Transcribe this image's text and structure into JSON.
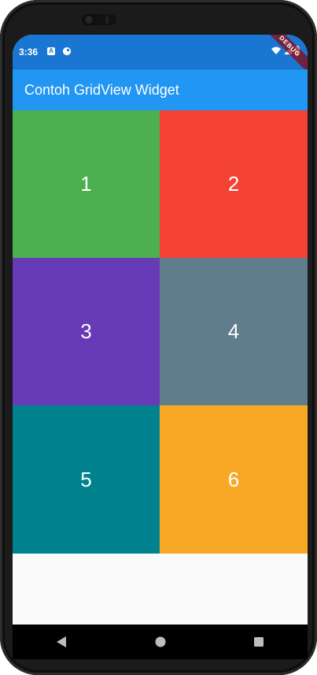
{
  "status_bar": {
    "time": "3:36",
    "debug_banner": "DEBUG",
    "icons": [
      "notification-a-icon",
      "notification-palette-icon",
      "wifi-icon",
      "signal-icon",
      "battery-icon"
    ]
  },
  "app_bar": {
    "title": "Contoh GridView Widget",
    "color": "#2196f3"
  },
  "grid": {
    "tiles": [
      {
        "label": "1",
        "color": "#4caf50"
      },
      {
        "label": "2",
        "color": "#f44336"
      },
      {
        "label": "3",
        "color": "#673ab7"
      },
      {
        "label": "4",
        "color": "#607d8b"
      },
      {
        "label": "5",
        "color": "#00838f"
      },
      {
        "label": "6",
        "color": "#f9a825"
      }
    ]
  },
  "navigation_bar": {
    "buttons": [
      "back-icon",
      "home-icon",
      "recents-icon"
    ]
  }
}
